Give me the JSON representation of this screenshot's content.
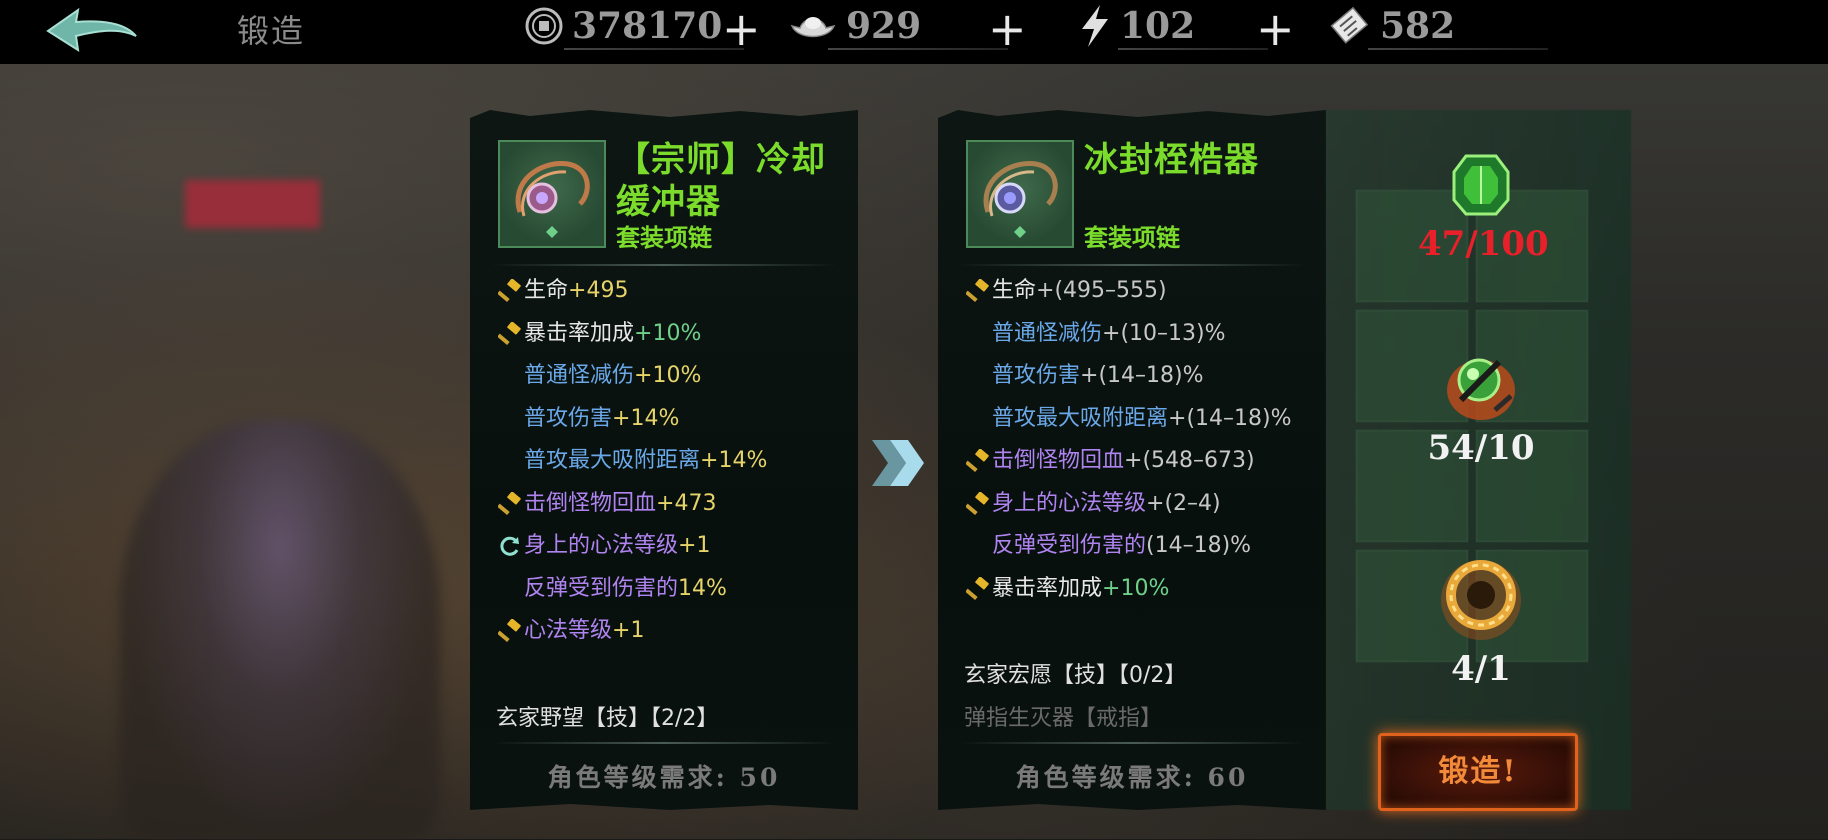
{
  "header": {
    "title": "锻造",
    "resources": [
      {
        "icon": "coin-icon",
        "value": "378170"
      },
      {
        "icon": "silver-ingot-icon",
        "value": "929"
      },
      {
        "icon": "lightning-icon",
        "value": "102"
      },
      {
        "icon": "ticket-icon",
        "value": "582"
      }
    ],
    "plus_label": "+"
  },
  "current_item": {
    "name_line1": "【宗师】冷却",
    "name_line2": "缓冲器",
    "type": "套装项链",
    "stats": [
      {
        "marker": "hammer",
        "label": "生命",
        "value": "+495",
        "label_color": "#e8e8e8",
        "value_color": "#e6d36a"
      },
      {
        "marker": "hammer",
        "label": "暴击率加成",
        "value": "+10%",
        "label_color": "#e8e8e8",
        "value_color": "#6fd08a"
      },
      {
        "marker": "none",
        "label": "普通怪减伤",
        "value": "+10%",
        "label_color": "#6aa8e8",
        "value_color": "#e6d36a"
      },
      {
        "marker": "none",
        "label": "普攻伤害",
        "value": "+14%",
        "label_color": "#6aa8e8",
        "value_color": "#e6d36a"
      },
      {
        "marker": "none",
        "label": "普攻最大吸附距离",
        "value": "+14%",
        "label_color": "#6aa8e8",
        "value_color": "#e6d36a"
      },
      {
        "marker": "hammer",
        "label": "击倒怪物回血",
        "value": "+473",
        "label_color": "#b084f0",
        "value_color": "#e6d36a"
      },
      {
        "marker": "reforge",
        "label": "身上的心法等级",
        "value": "+1",
        "label_color": "#b084f0",
        "value_color": "#e6d36a"
      },
      {
        "marker": "none",
        "label": "反弹受到伤害的",
        "value": "14%",
        "label_color": "#b084f0",
        "value_color": "#e6d36a"
      },
      {
        "marker": "hammer",
        "label": "心法等级",
        "value": "+1",
        "label_color": "#b084f0",
        "value_color": "#e6d36a"
      }
    ],
    "set_bonuses": [
      {
        "text": "玄家野望【技】【2/2】",
        "color": "#e0e0e0"
      }
    ],
    "level_requirement": "角色等级需求: 50"
  },
  "next_item": {
    "name_line1": "冰封桎梏器",
    "type": "套装项链",
    "stats": [
      {
        "marker": "hammer",
        "label": "生命",
        "value": "+(495–555)",
        "label_color": "#e8e8e8",
        "value_color": "#c8c8c8"
      },
      {
        "marker": "none",
        "label": "普通怪减伤",
        "value": "+(10–13)%",
        "label_color": "#6aa8e8",
        "value_color": "#c8c8c8"
      },
      {
        "marker": "none",
        "label": "普攻伤害",
        "value": "+(14–18)%",
        "label_color": "#6aa8e8",
        "value_color": "#c8c8c8"
      },
      {
        "marker": "none",
        "label": "普攻最大吸附距离",
        "value": "+(14–18)%",
        "label_color": "#6aa8e8",
        "value_color": "#c8c8c8"
      },
      {
        "marker": "hammer",
        "label": "击倒怪物回血",
        "value": "+(548–673)",
        "label_color": "#b084f0",
        "value_color": "#c8c8c8"
      },
      {
        "marker": "hammer",
        "label": "身上的心法等级",
        "value": "+(2–4)",
        "label_color": "#b084f0",
        "value_color": "#c8c8c8"
      },
      {
        "marker": "none",
        "label": "反弹受到伤害的",
        "value": "(14–18)%",
        "label_color": "#b084f0",
        "value_color": "#c8c8c8"
      },
      {
        "marker": "hammer",
        "label": "暴击率加成",
        "value": "+10%",
        "label_color": "#e8e8e8",
        "value_color": "#6fd08a"
      }
    ],
    "set_bonuses": [
      {
        "text": "玄家宏愿【技】【0/2】",
        "color": "#e0e0e0"
      },
      {
        "text": "弹指生灭器【戒指】",
        "color": "#6a6a6a"
      }
    ],
    "level_requirement": "角色等级需求: 60"
  },
  "materials": [
    {
      "icon": "green-gem-icon",
      "count": "47/100",
      "count_color": "#e8202a"
    },
    {
      "icon": "green-orb-icon",
      "count": "54/10",
      "count_color": "#f2f2f2"
    },
    {
      "icon": "golden-ring-icon",
      "count": "4/1",
      "count_color": "#f2f2f2"
    }
  ],
  "forge_button": "锻造!"
}
